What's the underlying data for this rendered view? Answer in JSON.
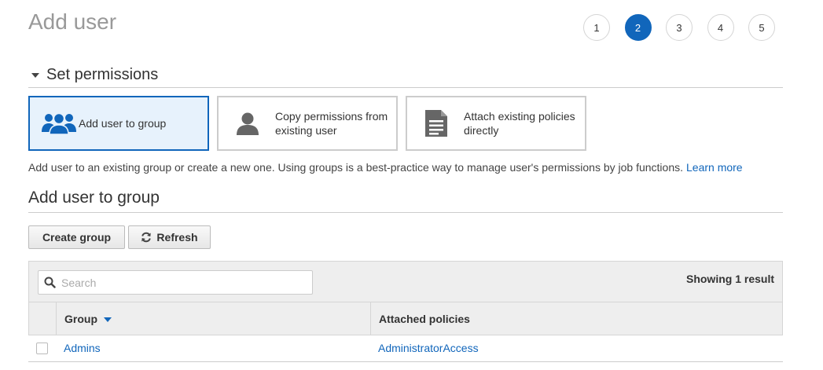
{
  "page": {
    "title": "Add user"
  },
  "steps": [
    "1",
    "2",
    "3",
    "4",
    "5"
  ],
  "active_step": "2",
  "permissions": {
    "section_title": "Set permissions",
    "options": [
      {
        "icon": "group-icon",
        "label_line1": "Add user to group",
        "label_line2": ""
      },
      {
        "icon": "user-icon",
        "label_line1": "Copy permissions from",
        "label_line2": "existing user"
      },
      {
        "icon": "document-icon",
        "label_line1": "Attach existing policies",
        "label_line2": "directly"
      }
    ],
    "selected_option": "Add user to group",
    "description": "Add user to an existing group or create a new one. Using groups is a best-practice way to manage user's permissions by job functions.",
    "learn_more": "Learn more"
  },
  "group_section": {
    "title": "Add user to group",
    "create_button": "Create group",
    "refresh_button": "Refresh"
  },
  "table": {
    "search_placeholder": "Search",
    "search_value": "",
    "result_count": "Showing 1 result",
    "columns": {
      "group": "Group",
      "policies": "Attached policies"
    },
    "rows": [
      {
        "group": "Admins",
        "policies": "AdministratorAccess",
        "checked": false
      }
    ]
  },
  "colors": {
    "accent": "#1166bb",
    "selected_bg": "#e7f2fc",
    "icon": "#666666"
  }
}
